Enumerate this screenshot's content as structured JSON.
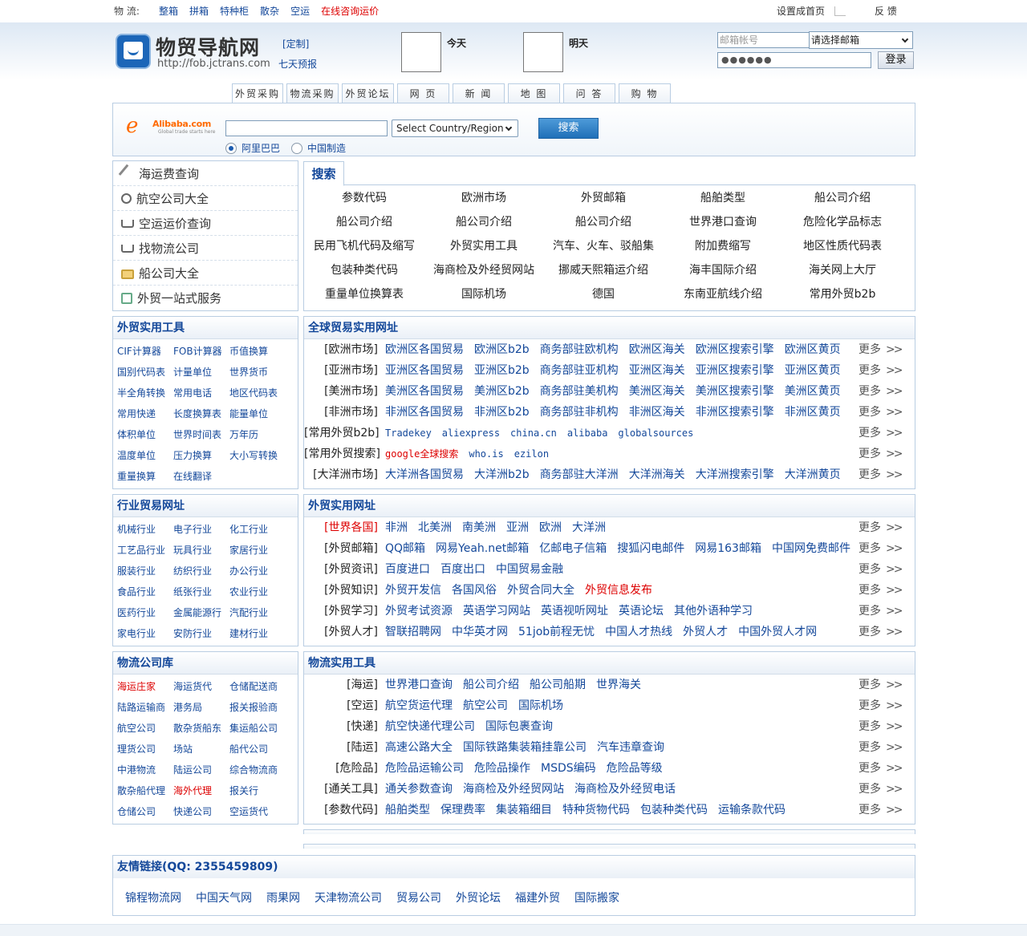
{
  "topbar": {
    "label": "物 流:",
    "links": [
      "整箱",
      "拼箱",
      "特种柜",
      "散杂",
      "空运"
    ],
    "inquiry": "在线咨询运价",
    "set_home": "设置成首页",
    "feedback": "反 馈"
  },
  "header": {
    "brand": "物贸导航网",
    "url": "http://fob.jctrans.com",
    "custom": "[定制]",
    "forecast": "七天预报",
    "today": "今天",
    "tomorrow": "明天"
  },
  "login": {
    "mail_placeholder": "邮箱帐号",
    "mail_select": "请选择邮箱",
    "password_mask": "●●●●●●",
    "login_button": "登录"
  },
  "tabs": [
    "外贸采购",
    "物流采购",
    "外贸论坛",
    "网 页",
    "新 闻",
    "地 图",
    "问 答",
    "购 物"
  ],
  "alibaba": {
    "logo_text": "Alibaba.com",
    "logo_sub": "Global trade starts here",
    "country_select": "Select Country/Region",
    "search_button": "搜索",
    "radio1": "阿里巴巴",
    "radio2": "中国制造"
  },
  "left_menu": [
    {
      "label": "海运费查询",
      "icon": "tool-icon"
    },
    {
      "label": "航空公司大全",
      "icon": "magnifier-icon"
    },
    {
      "label": "空运运价查询",
      "icon": "cart-icon"
    },
    {
      "label": "找物流公司",
      "icon": "cart-icon"
    },
    {
      "label": "船公司大全",
      "icon": "lock-icon"
    },
    {
      "label": "外贸一站式服务",
      "icon": "pen-icon"
    }
  ],
  "search_tab": {
    "title": "搜索",
    "rows": [
      [
        "参数代码",
        "欧洲市场",
        "外贸邮箱",
        "船舶类型",
        "船公司介绍"
      ],
      [
        "船公司介绍",
        "船公司介绍",
        "船公司介绍",
        "世界港口查询",
        "危险化学品标志"
      ],
      [
        "民用飞机代码及缩写",
        "外贸实用工具",
        "汽车、火车、驳船集",
        "附加费缩写",
        "地区性质代码表"
      ],
      [
        "包装种类代码",
        "海商检及外经贸网站",
        "挪威天熙箱运介绍",
        "海丰国际介绍",
        "海关网上大厅"
      ],
      [
        "重量单位换算表",
        "国际机场",
        "德国",
        "东南亚航线介绍",
        "常用外贸b2b"
      ]
    ]
  },
  "tools_panel": {
    "title": "外贸实用工具",
    "rows": [
      [
        "CIF计算器",
        "FOB计算器",
        "币值换算"
      ],
      [
        "国别代码表",
        "计量单位",
        "世界货币"
      ],
      [
        "半全角转换",
        "常用电话",
        "地区代码表"
      ],
      [
        "常用快递",
        "长度换算表",
        "能量单位"
      ],
      [
        "体积单位",
        "世界时间表",
        "万年历"
      ],
      [
        "温度单位",
        "压力换算",
        "大小写转换"
      ],
      [
        "重量换算",
        "在线翻译",
        ""
      ]
    ]
  },
  "industry_panel": {
    "title": "行业贸易网址",
    "rows": [
      [
        "机械行业",
        "电子行业",
        "化工行业"
      ],
      [
        "工艺品行业",
        "玩具行业",
        "家居行业"
      ],
      [
        "服装行业",
        "纺织行业",
        "办公行业"
      ],
      [
        "食品行业",
        "纸张行业",
        "农业行业"
      ],
      [
        "医药行业",
        "金属能源行",
        "汽配行业"
      ],
      [
        "家电行业",
        "安防行业",
        "建材行业"
      ]
    ]
  },
  "logistics_panel": {
    "title": "物流公司库",
    "rows": [
      [
        "海运庄家",
        "海运货代",
        "仓储配送商"
      ],
      [
        "陆路运输商",
        "港务局",
        "报关报验商"
      ],
      [
        "航空公司",
        "散杂货船东",
        "集运船公司"
      ],
      [
        "理货公司",
        "场站",
        "船代公司"
      ],
      [
        "中港物流",
        "陆运公司",
        "综合物流商"
      ],
      [
        "散杂船代理",
        "海外代理",
        "报关行"
      ],
      [
        "仓储公司",
        "快递公司",
        "空运货代"
      ]
    ],
    "red": [
      "海运庄家",
      "海外代理"
    ]
  },
  "global_panel": {
    "title": "全球贸易实用网址",
    "more": "更多",
    "rows": [
      {
        "label": "[欧洲市场]",
        "links": [
          "欧洲区各国贸易",
          "欧洲区b2b",
          "商务部驻欧机构",
          "欧洲区海关",
          "欧洲区搜索引擎",
          "欧洲区黄页"
        ]
      },
      {
        "label": "[亚洲市场]",
        "links": [
          "亚洲区各国贸易",
          "亚洲区b2b",
          "商务部驻亚机构",
          "亚洲区海关",
          "亚洲区搜索引擎",
          "亚洲区黄页"
        ]
      },
      {
        "label": "[美洲市场]",
        "links": [
          "美洲区各国贸易",
          "美洲区b2b",
          "商务部驻美机构",
          "美洲区海关",
          "美洲区搜索引擎",
          "美洲区黄页"
        ]
      },
      {
        "label": "[非洲市场]",
        "links": [
          "非洲区各国贸易",
          "非洲区b2b",
          "商务部驻非机构",
          "非洲区海关",
          "非洲区搜索引擎",
          "非洲区黄页"
        ]
      },
      {
        "label": "[常用外贸b2b]",
        "links": [
          "Tradekey",
          "aliexpress",
          "china.cn",
          "alibaba",
          "globalsources"
        ],
        "mono": true
      },
      {
        "label": "[常用外贸搜索]",
        "links": [
          "google全球搜索",
          "who.is",
          "ezilon"
        ],
        "mono": true,
        "red_first": true
      },
      {
        "label": "[大洋洲市场]",
        "links": [
          "大洋洲各国贸易",
          "大洋洲b2b",
          "商务部驻大洋洲",
          "大洋洲海关",
          "大洋洲搜索引擎",
          "大洋洲黄页"
        ]
      }
    ]
  },
  "trade_panel": {
    "title": "外贸实用网址",
    "more": "更多",
    "rows": [
      {
        "label": "[世界各国]",
        "links": [
          "非洲",
          "北美洲",
          "南美洲",
          "亚洲",
          "欧洲",
          "大洋洲"
        ],
        "label_red": true
      },
      {
        "label": "[外贸邮箱]",
        "links": [
          "QQ邮箱",
          "网易Yeah.net邮箱",
          "亿邮电子信箱",
          "搜狐闪电邮件",
          "网易163邮箱",
          "中国网免费邮件"
        ]
      },
      {
        "label": "[外贸资讯]",
        "links": [
          "百度进口",
          "百度出口",
          "中国贸易金融"
        ]
      },
      {
        "label": "[外贸知识]",
        "links": [
          "外贸开发信",
          "各国风俗",
          "外贸合同大全",
          "外贸信息发布"
        ],
        "red_last": true
      },
      {
        "label": "[外贸学习]",
        "links": [
          "外贸考试资源",
          "英语学习网站",
          "英语视听网址",
          "英语论坛",
          "其他外语种学习"
        ]
      },
      {
        "label": "[外贸人才]",
        "links": [
          "智联招聘网",
          "中华英才网",
          "51job前程无忧",
          "中国人才热线",
          "外贸人才",
          "中国外贸人才网"
        ]
      }
    ]
  },
  "logtools_panel": {
    "title": "物流实用工具",
    "more": "更多",
    "rows": [
      {
        "label": "[海运]",
        "links": [
          "世界港口查询",
          "船公司介绍",
          "船公司船期",
          "世界海关"
        ]
      },
      {
        "label": "[空运]",
        "links": [
          "航空货运代理",
          "航空公司",
          "国际机场"
        ]
      },
      {
        "label": "[快递]",
        "links": [
          "航空快递代理公司",
          "国际包裹查询"
        ]
      },
      {
        "label": "[陆运]",
        "links": [
          "高速公路大全",
          "国际铁路集装箱挂靠公司",
          "汽车违章查询"
        ]
      },
      {
        "label": "[危险品]",
        "links": [
          "危险品运输公司",
          "危险品操作",
          "MSDS编码",
          "危险品等级"
        ]
      },
      {
        "label": "[通关工具]",
        "links": [
          "通关参数查询",
          "海商检及外经贸网站",
          "海商检及外经贸电话"
        ]
      },
      {
        "label": "[参数代码]",
        "links": [
          "船舶类型",
          "保理费率",
          "集装箱细目",
          "特种货物代码",
          "包装种类代码",
          "运输条款代码"
        ]
      }
    ]
  },
  "friend_links": {
    "title": "友情链接(QQ: 2355459809)",
    "links": [
      "锦程物流网",
      "中国天气网",
      "雨果网",
      "天津物流公司",
      "贸易公司",
      "外贸论坛",
      "福建外贸",
      "国际搬家"
    ]
  }
}
